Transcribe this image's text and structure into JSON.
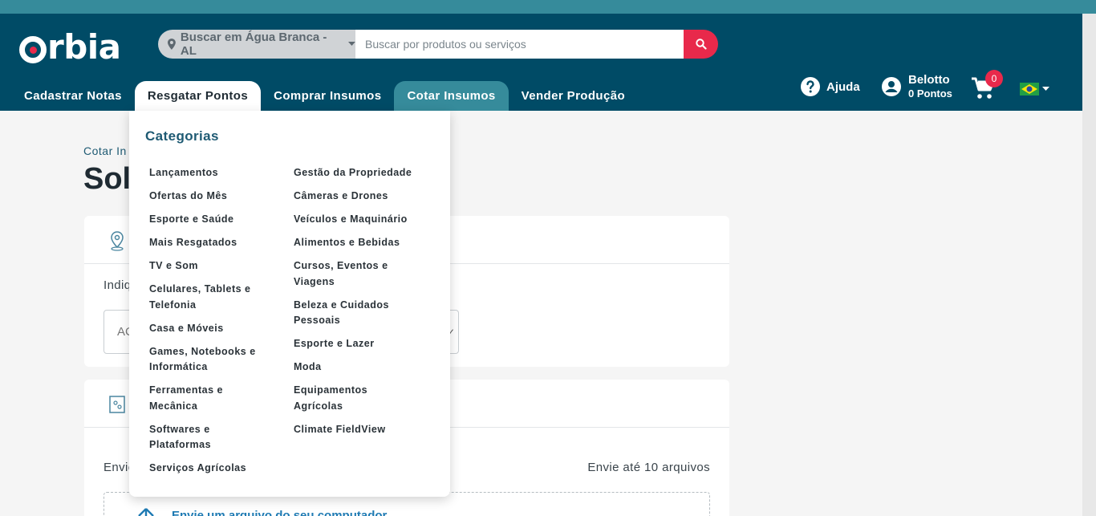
{
  "header": {
    "logo_text": "rbia",
    "location_label": "Buscar em Água Branca - AL",
    "search_placeholder": "Buscar por produtos ou serviços",
    "help_label": "Ajuda",
    "user_name": "Belotto",
    "user_points": "0 Pontos",
    "cart_count": "0"
  },
  "nav": {
    "items": [
      {
        "label": "Cadastrar Notas"
      },
      {
        "label": "Resgatar Pontos"
      },
      {
        "label": "Comprar Insumos"
      },
      {
        "label": "Cotar Insumos"
      },
      {
        "label": "Vender Produção"
      }
    ]
  },
  "page": {
    "breadcrumb": "Cotar In",
    "title": "Sol",
    "card1_text": "Indiq",
    "select_value": "AC",
    "card2_text": "Envie",
    "files_limit": "Envie até 10 arquivos",
    "upload_text": "Envie um arquivo do seu computador"
  },
  "dropdown": {
    "title": "Categorias",
    "col1": [
      "Lançamentos",
      "Ofertas do Mês",
      "Esporte e Saúde",
      "Mais Resgatados",
      "TV e Som",
      "Celulares, Tablets e Telefonia",
      "Casa e Móveis",
      "Games, Notebooks e Informática",
      "Ferramentas e Mecânica",
      "Softwares e Plataformas",
      "Serviços Agrícolas"
    ],
    "col2": [
      "Gestão da Propriedade",
      "Câmeras e Drones",
      "Veículos e Maquinário",
      "Alimentos e Bebidas",
      "Cursos, Eventos e Viagens",
      "Beleza e Cuidados Pessoais",
      "Esporte e Lazer",
      "Moda",
      "Equipamentos Agrícolas",
      "Climate FieldView"
    ]
  },
  "colors": {
    "header_bg": "#004b66",
    "top_strip": "#368b9b",
    "accent_red": "#e8294b",
    "highlight_tab": "#368b9b"
  }
}
